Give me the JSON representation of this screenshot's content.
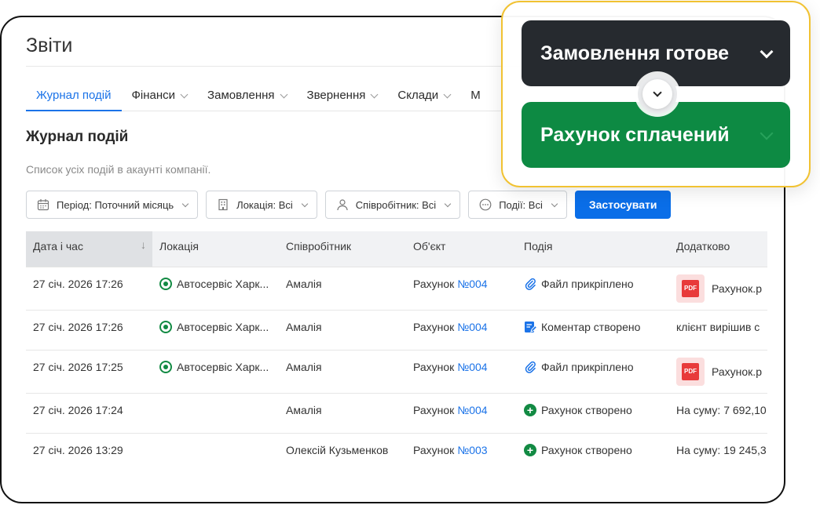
{
  "page": {
    "title": "Звіти"
  },
  "tabs": [
    {
      "label": "Журнал подій",
      "active": true
    },
    {
      "label": "Фінанси"
    },
    {
      "label": "Замовлення"
    },
    {
      "label": "Звернення"
    },
    {
      "label": "Склади"
    },
    {
      "label": "М"
    }
  ],
  "section": {
    "title": "Журнал подій",
    "subtitle": "Список усіх подій в акаунті компанії."
  },
  "filters": {
    "period": "Період: Поточний місяць",
    "location": "Локація: Всі",
    "employee": "Співробітник: Всі",
    "events": "Події: Всі",
    "apply": "Застосувати"
  },
  "table": {
    "columns": [
      "Дата і час",
      "Локація",
      "Співробітник",
      "Об'єкт",
      "Подія",
      "Додатково"
    ],
    "rows": [
      {
        "datetime": "27 січ. 2026 17:26",
        "location": "Автосервіс Харк...",
        "employee": "Амалія",
        "object_prefix": "Рахунок ",
        "object_link": "№004",
        "event": "Файл прикріплено",
        "event_icon": "paperclip-icon",
        "extra": "Рахунок.p",
        "extra_type": "pdf"
      },
      {
        "datetime": "27 січ. 2026 17:26",
        "location": "Автосервіс Харк...",
        "employee": "Амалія",
        "object_prefix": "Рахунок ",
        "object_link": "№004",
        "event": "Коментар створено",
        "event_icon": "comment-edit-icon",
        "extra": "клієнт вирішив с",
        "extra_type": "text"
      },
      {
        "datetime": "27 січ. 2026 17:25",
        "location": "Автосервіс Харк...",
        "employee": "Амалія",
        "object_prefix": "Рахунок ",
        "object_link": "№004",
        "event": "Файл прикріплено",
        "event_icon": "paperclip-icon",
        "extra": "Рахунок.p",
        "extra_type": "pdf"
      },
      {
        "datetime": "27 січ. 2026 17:24",
        "location": "",
        "employee": "Амалія",
        "object_prefix": "Рахунок ",
        "object_link": "№004",
        "event": "Рахунок створено",
        "event_icon": "plus-circle-icon",
        "extra": "На суму: 7 692,10",
        "extra_type": "text"
      },
      {
        "datetime": "27 січ. 2026 13:29",
        "location": "",
        "employee": "Олексій Кузьменков",
        "object_prefix": "Рахунок ",
        "object_link": "№003",
        "event": "Рахунок створено",
        "event_icon": "plus-circle-icon",
        "extra": "На суму: 19 245,3",
        "extra_type": "text"
      }
    ]
  },
  "popup": {
    "card_top": "Замовлення готове",
    "card_bottom": "Рахунок сплачений"
  },
  "colors": {
    "accent": "#1b73e8",
    "green": "#0d8a43",
    "dark_card": "#262a2f",
    "popup_border": "#f1c232"
  }
}
